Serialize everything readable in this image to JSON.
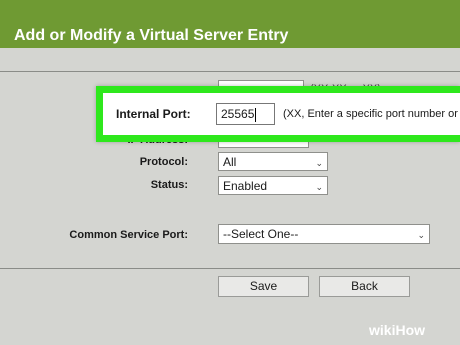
{
  "header": {
    "title": "Add or Modify a Virtual Server Entry"
  },
  "top_row": {
    "hint": "(XX-XX or XX)"
  },
  "internal_port": {
    "label": "Internal Port:",
    "value": "25565",
    "hint": "(XX, Enter a specific port number or"
  },
  "ip_address": {
    "label": "IP Address:"
  },
  "protocol": {
    "label": "Protocol:",
    "value": "All"
  },
  "status": {
    "label": "Status:",
    "value": "Enabled"
  },
  "common_service_port": {
    "label": "Common Service Port:",
    "value": "--Select One--"
  },
  "buttons": {
    "save": "Save",
    "back": "Back"
  },
  "watermark": {
    "wiki": "wiki",
    "how": "How"
  },
  "colors": {
    "header": "#6f9a33",
    "callout_border": "#2ee81c",
    "background": "#d4d5d1"
  }
}
